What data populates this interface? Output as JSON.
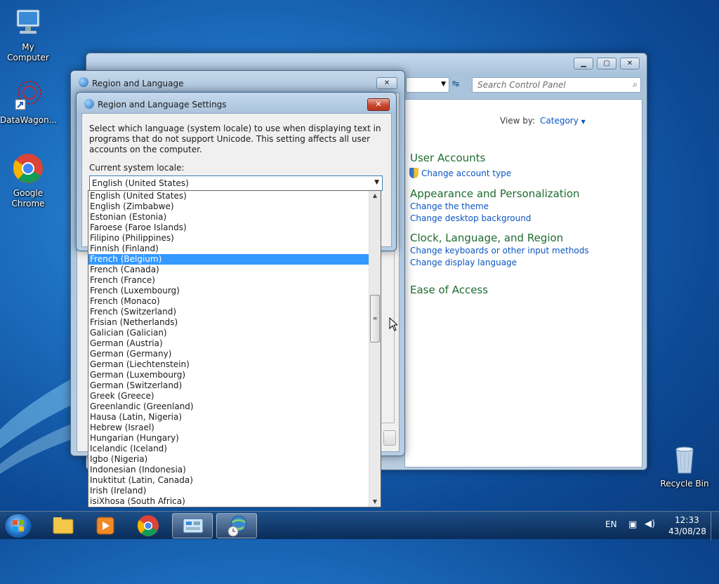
{
  "desktop": {
    "icons": [
      {
        "label": "My Computer",
        "icon": "computer-icon"
      },
      {
        "label": "DataWagon...",
        "icon": "datawagon-icon"
      },
      {
        "label": "Google Chrome",
        "icon": "chrome-icon"
      },
      {
        "label": "Recycle Bin",
        "icon": "recycle-bin-icon"
      }
    ]
  },
  "control_panel": {
    "search_placeholder": "Search Control Panel",
    "view_by_label": "View by:",
    "view_by_value": "Category",
    "sections": [
      {
        "heading": "User Accounts",
        "links": [
          "Change account type"
        ]
      },
      {
        "heading": "Appearance and Personalization",
        "links": [
          "Change the theme",
          "Change desktop background"
        ]
      },
      {
        "heading": "Clock, Language, and Region",
        "links": [
          "Change keyboards or other input methods",
          "Change display language"
        ]
      },
      {
        "heading": "Ease of Access",
        "links": []
      }
    ]
  },
  "region_dialog": {
    "title": "Region and Language"
  },
  "settings_dialog": {
    "title": "Region and Language Settings",
    "description": "Select which language (system locale) to use when displaying text in programs that do not support Unicode. This setting affects all user accounts on the computer.",
    "locale_label": "Current system locale:",
    "locale_value": "English (United States)",
    "close_label": "✕"
  },
  "dropdown": {
    "selected": "French (Belgium)",
    "items": [
      "English (United States)",
      "English (Zimbabwe)",
      "Estonian (Estonia)",
      "Faroese (Faroe Islands)",
      "Filipino (Philippines)",
      "Finnish (Finland)",
      "French (Belgium)",
      "French (Canada)",
      "French (France)",
      "French (Luxembourg)",
      "French (Monaco)",
      "French (Switzerland)",
      "Frisian (Netherlands)",
      "Galician (Galician)",
      "German (Austria)",
      "German (Germany)",
      "German (Liechtenstein)",
      "German (Luxembourg)",
      "German (Switzerland)",
      "Greek (Greece)",
      "Greenlandic (Greenland)",
      "Hausa (Latin, Nigeria)",
      "Hebrew (Israel)",
      "Hungarian (Hungary)",
      "Icelandic (Iceland)",
      "Igbo (Nigeria)",
      "Indonesian (Indonesia)",
      "Inuktitut (Latin, Canada)",
      "Irish (Ireland)",
      "isiXhosa (South Africa)"
    ]
  },
  "taskbar": {
    "language": "EN",
    "time": "12:33",
    "date": "43/08/28"
  }
}
